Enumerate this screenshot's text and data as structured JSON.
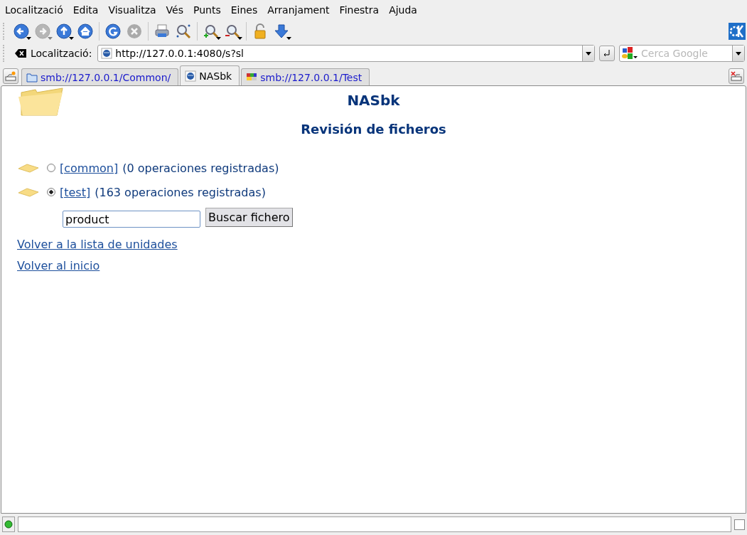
{
  "menu": [
    "Localització",
    "Edita",
    "Visualitza",
    "Vés",
    "Punts",
    "Eines",
    "Arranjament",
    "Finestra",
    "Ajuda"
  ],
  "toolbar": [
    [
      {
        "kind": "back",
        "disabled": false,
        "dropdown": true
      },
      {
        "kind": "forward",
        "disabled": true,
        "dropdown": true
      },
      {
        "kind": "up",
        "disabled": false,
        "dropdown": true
      },
      {
        "kind": "home",
        "disabled": false,
        "dropdown": false
      }
    ],
    [
      {
        "kind": "reload",
        "disabled": false,
        "dropdown": false
      },
      {
        "kind": "stop",
        "disabled": true,
        "dropdown": false
      }
    ],
    [
      {
        "kind": "print",
        "disabled": false,
        "dropdown": false
      },
      {
        "kind": "find",
        "disabled": false,
        "dropdown": false
      }
    ],
    [
      {
        "kind": "zoom-in",
        "disabled": false,
        "dropdown": true
      },
      {
        "kind": "zoom-out",
        "disabled": false,
        "dropdown": true
      }
    ],
    [
      {
        "kind": "lock",
        "disabled": false,
        "dropdown": false
      },
      {
        "kind": "download",
        "disabled": false,
        "dropdown": true
      }
    ]
  ],
  "location_bar": {
    "label": "Localització:",
    "url": "http://127.0.0.1:4080/s?sl",
    "search_placeholder": "Cerca Google"
  },
  "tabs": [
    {
      "label": "smb://127.0.0.1/Common/",
      "kind": "folder",
      "selected": false
    },
    {
      "label": "NASbk",
      "kind": "globe",
      "selected": true
    },
    {
      "label": "smb://127.0.0.1/Test",
      "kind": "grid",
      "selected": false
    }
  ],
  "page": {
    "title": "NASbk",
    "subtitle": "Revisión de ficheros",
    "units": [
      {
        "link": "[common]",
        "count": "(0 operaciones registradas)",
        "selected": false
      },
      {
        "link": "[test]",
        "count": "(163 operaciones registradas)",
        "selected": true
      }
    ],
    "search": {
      "value": "product",
      "button": "Buscar fichero"
    },
    "links": [
      "Volver a la lista de unidades",
      "Volver al inicio"
    ]
  },
  "status_bar": {
    "checked": false
  }
}
